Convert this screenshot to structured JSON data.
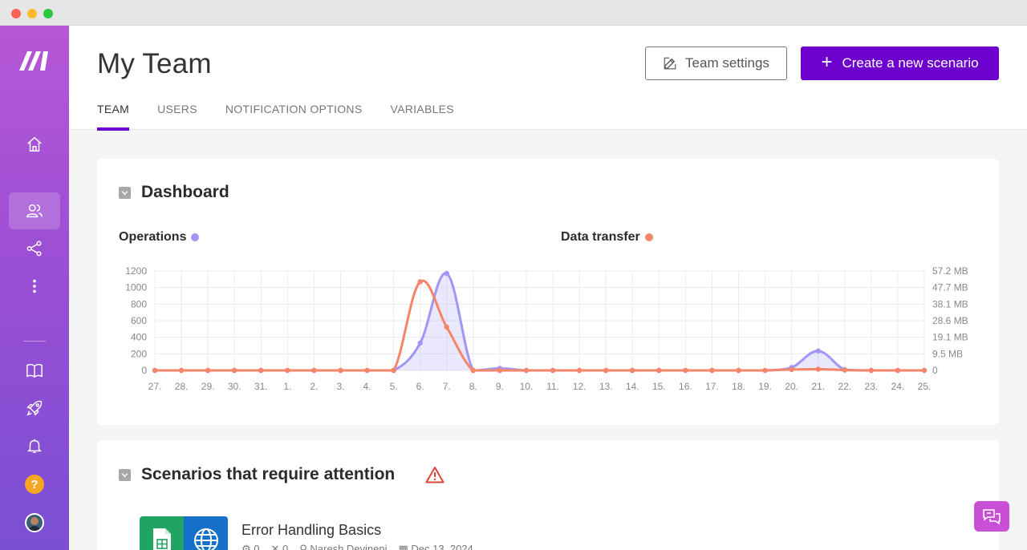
{
  "header": {
    "title": "My Team",
    "settings_label": "Team settings",
    "create_label": "Create a new scenario",
    "create_plus": "+"
  },
  "tabs": [
    {
      "label": "TEAM",
      "active": true
    },
    {
      "label": "USERS",
      "active": false
    },
    {
      "label": "NOTIFICATION OPTIONS",
      "active": false
    },
    {
      "label": "VARIABLES",
      "active": false
    }
  ],
  "sidebar": {
    "items": [
      {
        "icon": "home-icon"
      },
      {
        "icon": "team-icon",
        "active": true
      },
      {
        "icon": "share-icon"
      },
      {
        "icon": "more-icon"
      },
      {
        "icon": "book-icon"
      },
      {
        "icon": "rocket-icon"
      },
      {
        "icon": "bell-icon"
      },
      {
        "icon": "help-icon",
        "text": "?"
      },
      {
        "icon": "avatar"
      }
    ]
  },
  "dashboard": {
    "title": "Dashboard",
    "legend_operations": "Operations",
    "legend_transfer": "Data transfer"
  },
  "attention": {
    "title": "Scenarios that require attention",
    "scenario": {
      "name": "Error Handling Basics",
      "ops": "0",
      "errors": "0",
      "owner": "Naresh Devineni",
      "date": "Dec 13, 2024"
    }
  },
  "colors": {
    "accent": "#6d00cc",
    "operations": "#9f96f5",
    "transfer": "#f58468",
    "sidebar_top": "#b657d6",
    "sidebar_bottom": "#7a4fd4"
  },
  "chart_data": {
    "type": "line",
    "categories": [
      "27.",
      "28.",
      "29.",
      "30.",
      "31.",
      "1.",
      "2.",
      "3.",
      "4.",
      "5.",
      "6.",
      "7.",
      "8.",
      "9.",
      "10.",
      "11.",
      "12.",
      "13.",
      "14.",
      "15.",
      "16.",
      "17.",
      "18.",
      "19.",
      "20.",
      "21.",
      "22.",
      "23.",
      "24.",
      "25."
    ],
    "y_left": {
      "ticks": [
        "1200",
        "1000",
        "800",
        "600",
        "400",
        "200",
        "0"
      ],
      "range": [
        0,
        1200
      ]
    },
    "y_right": {
      "ticks": [
        "57.2 MB",
        "47.7 MB",
        "38.1 MB",
        "28.6 MB",
        "19.1 MB",
        "9.5 MB",
        "0"
      ],
      "range": [
        0,
        57.2
      ]
    },
    "series": [
      {
        "name": "Operations",
        "axis": "left",
        "color": "#9f96f5",
        "values": [
          0,
          0,
          0,
          0,
          0,
          0,
          0,
          0,
          0,
          0,
          330,
          1170,
          0,
          25,
          0,
          0,
          0,
          0,
          0,
          0,
          0,
          0,
          0,
          0,
          35,
          235,
          10,
          0,
          0,
          0
        ]
      },
      {
        "name": "Data transfer",
        "axis": "right",
        "color": "#f58468",
        "values": [
          0,
          0,
          0,
          0,
          0,
          0,
          0,
          0,
          0,
          0,
          51,
          24.9,
          0,
          0,
          0,
          0,
          0,
          0,
          0,
          0,
          0,
          0,
          0,
          0,
          0.5,
          0.7,
          0.2,
          0,
          0,
          0
        ]
      }
    ],
    "grid": true,
    "legend": "top"
  }
}
